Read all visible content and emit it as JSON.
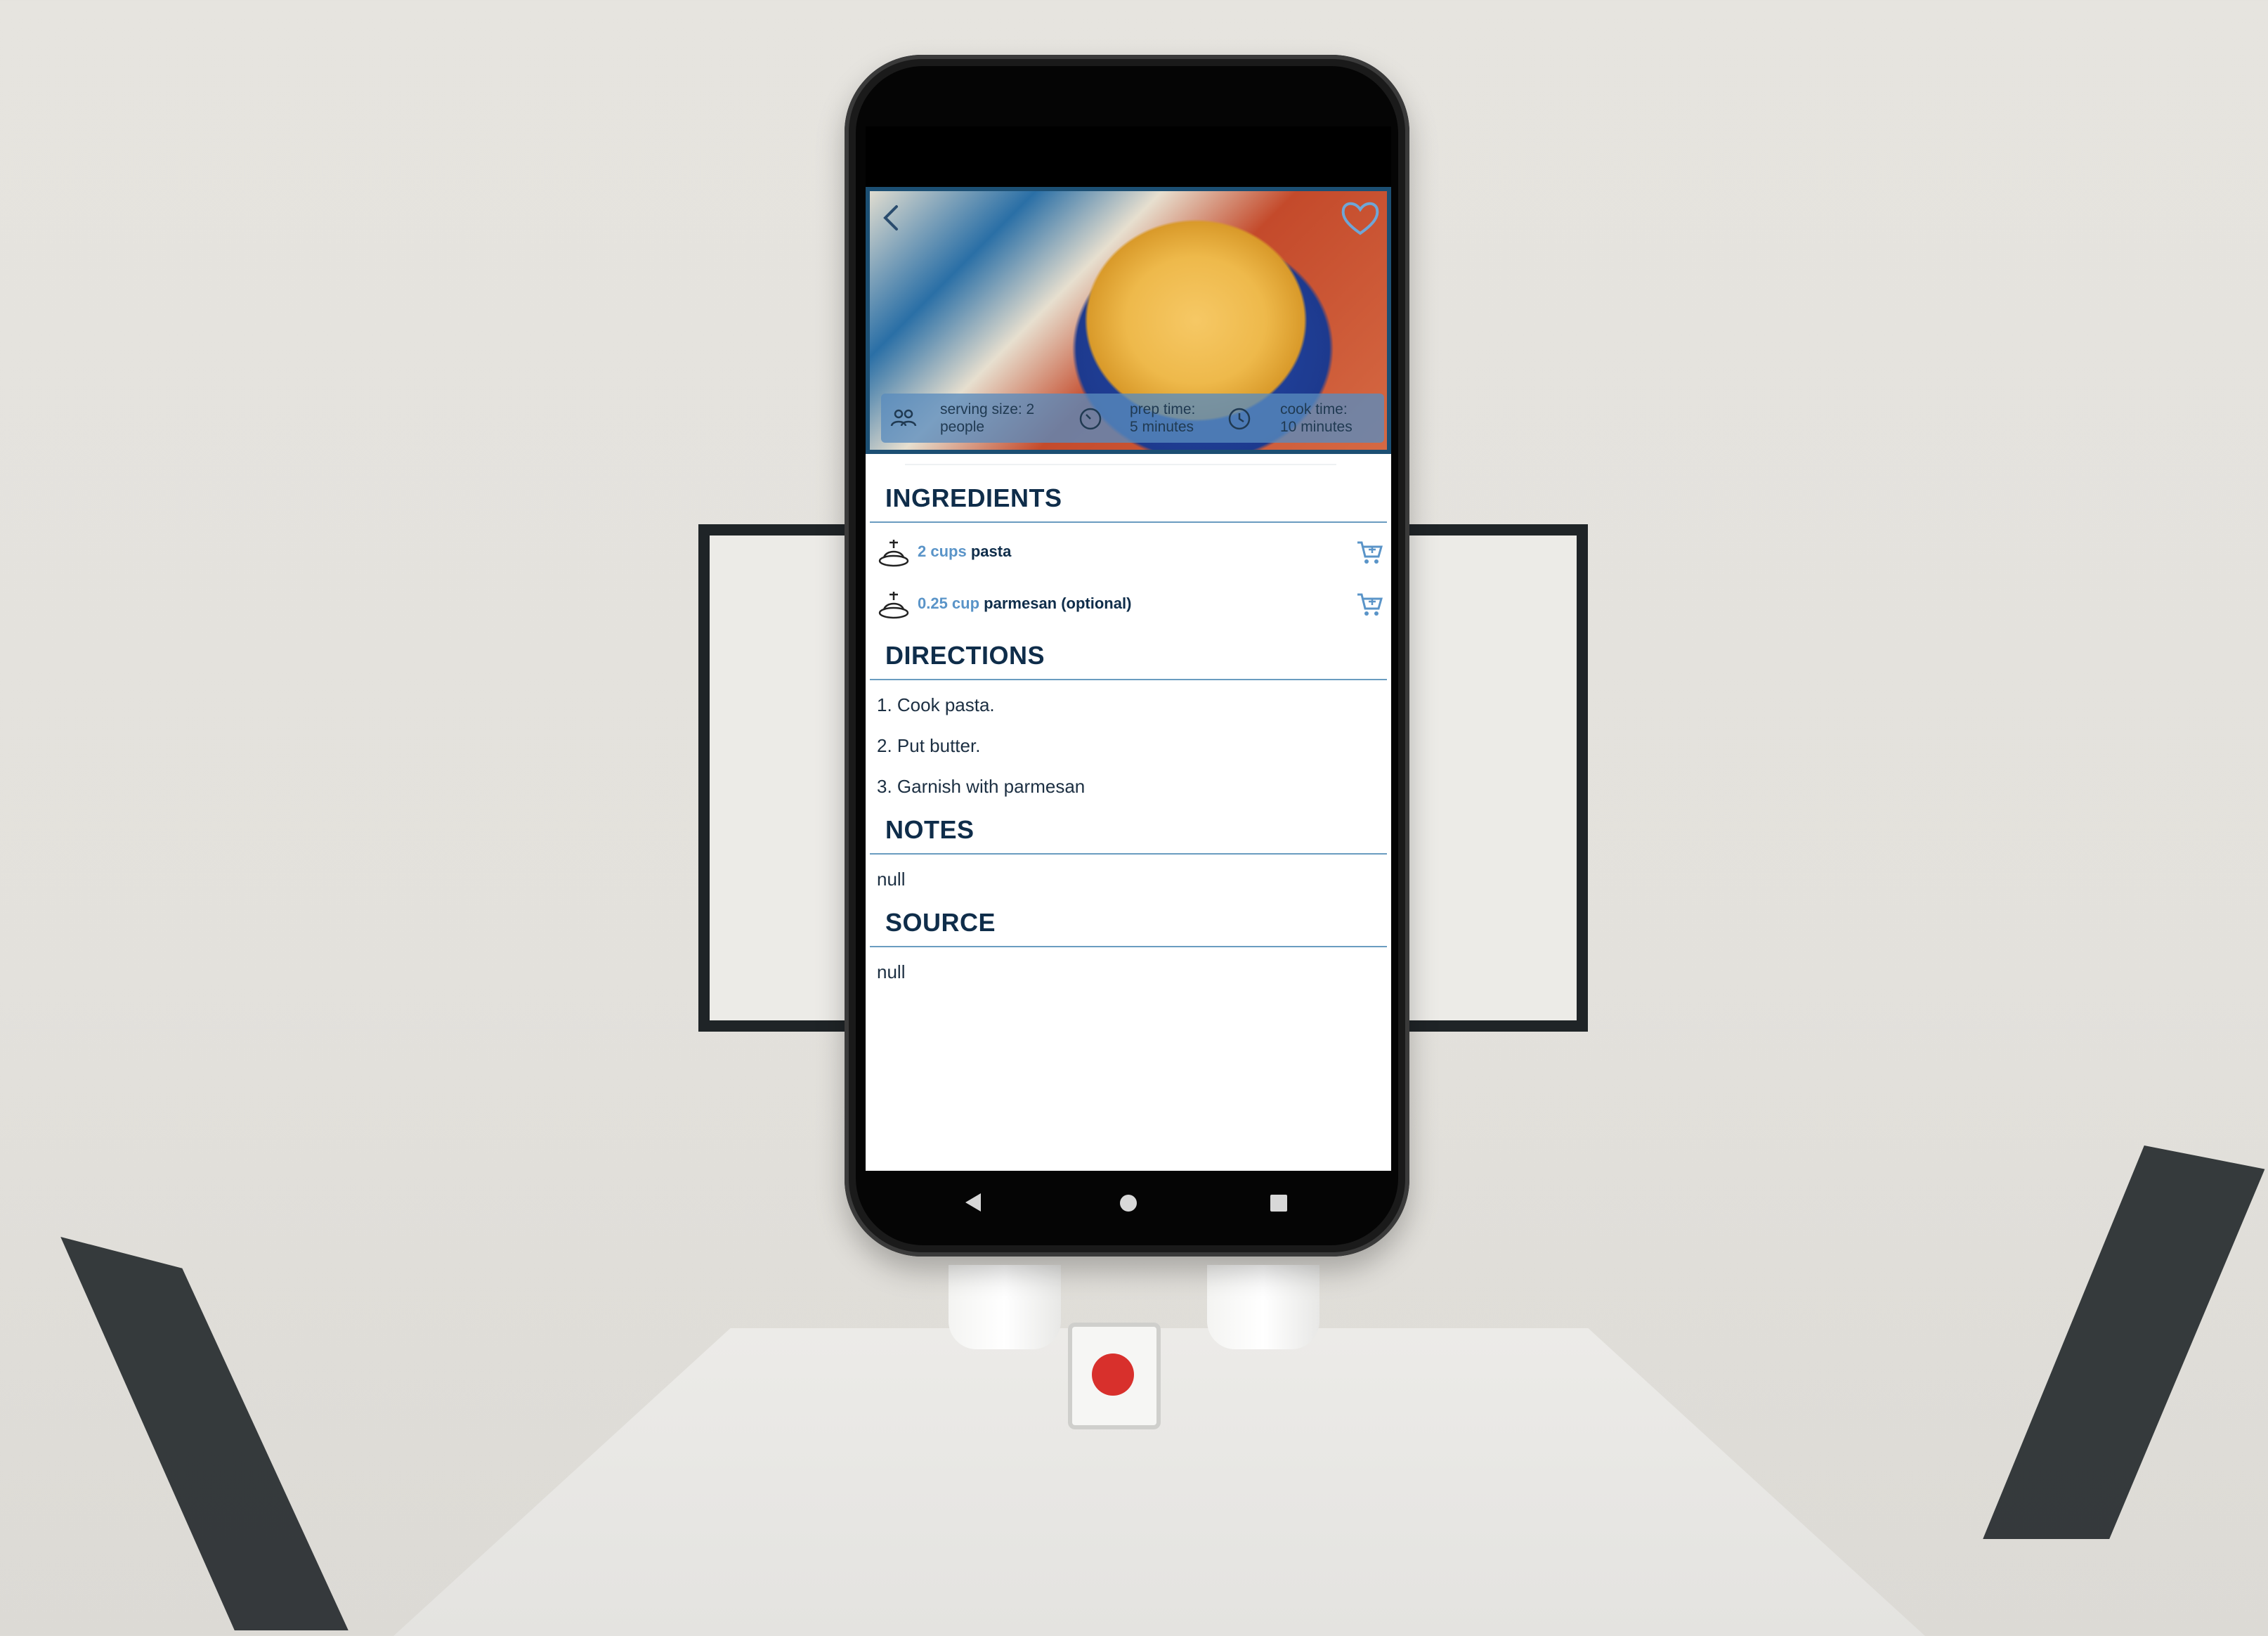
{
  "hero": {
    "stats": [
      {
        "icon": "people-icon",
        "label": "serving size: 2",
        "value": "people"
      },
      {
        "icon": "timer-icon",
        "label": "prep time:",
        "value": "5 minutes"
      },
      {
        "icon": "clock-icon",
        "label": "cook time:",
        "value": "10 minutes"
      }
    ]
  },
  "ingredients": {
    "heading": "INGREDIENTS",
    "items": [
      {
        "qty": "2 cups",
        "name": "pasta"
      },
      {
        "qty": "0.25 cup",
        "name": "parmesan (optional)"
      }
    ]
  },
  "directions": {
    "heading": "DIRECTIONS",
    "steps": [
      "1. Cook pasta.",
      "2. Put butter.",
      "3. Garnish with parmesan"
    ]
  },
  "notes": {
    "heading": "NOTES",
    "text": "null"
  },
  "source": {
    "heading": "SOURCE",
    "text": "null"
  },
  "colors": {
    "accent": "#5a94c8",
    "heading": "#0f2d4a",
    "rule": "#6a9cc0"
  }
}
